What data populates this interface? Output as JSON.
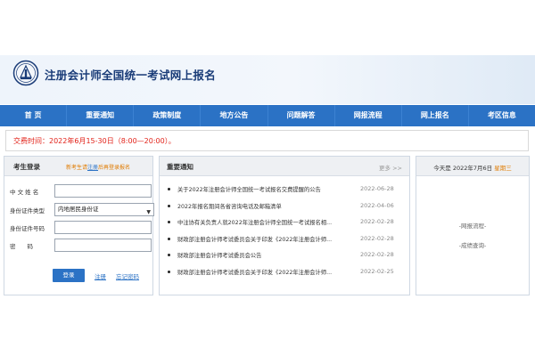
{
  "header": {
    "logo_icon": "emblem-icon",
    "title": "注册会计师全国统一考试网上报名"
  },
  "nav": {
    "items": [
      "首 页",
      "重要通知",
      "政策制度",
      "地方公告",
      "问题解答",
      "网报流程",
      "网上报名",
      "考区信息"
    ]
  },
  "notice": {
    "text": "交费时间：2022年6月15-30日（8:00—20:00）。"
  },
  "login": {
    "title": "考生登录",
    "register_prefix": "新考生请",
    "register_link": "注册",
    "register_suffix": "后再登录报名",
    "fields": {
      "name_label": "中 文 姓 名",
      "id_type_label": "身份证件类型",
      "id_type_value": "内地居民身份证",
      "id_number_label": "身份证件号码",
      "password_label": "密　　码"
    },
    "login_button": "登录",
    "register_button": "注册",
    "forgot_password": "忘记密码"
  },
  "news": {
    "title": "重要通知",
    "more": "更多 >>",
    "items": [
      {
        "title": "关于2022年注册会计师全国统一考试报名交费提醒的公告",
        "date": "2022-06-28"
      },
      {
        "title": "2022年报名期间各省咨询电话及邮箱清单",
        "date": "2022-04-06"
      },
      {
        "title": "中注协有关负责人就2022年注册会计师全国统一考试报名相...",
        "date": "2022-02-28"
      },
      {
        "title": "财政部注册会计师考试委员会关于印发《2022年注册会计师...",
        "date": "2022-02-28"
      },
      {
        "title": "财政部注册会计师考试委员会公告",
        "date": "2022-02-28"
      },
      {
        "title": "财政部注册会计师考试委员会关于印发《2022年注册会计师...",
        "date": "2022-02-25"
      }
    ]
  },
  "today": {
    "prefix": "今天是",
    "date": "2022年7月6日",
    "weekday": "星期三",
    "links": [
      "-网报流程-",
      "-成绩查询-"
    ]
  }
}
